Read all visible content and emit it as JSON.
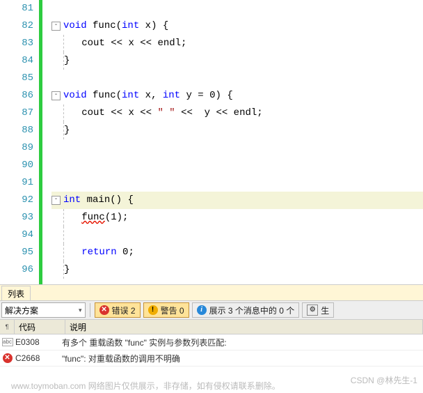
{
  "lines": {
    "81": "",
    "82_kw": "void",
    "82_fn": "func",
    "82_typ": "int",
    "82_p": "x",
    "83_stmt_a": "cout ",
    "83_stmt_b": "<< x << endl;",
    "86_kw": "void",
    "86_fn": "func",
    "86_t1": "int",
    "86_p1": "x",
    "86_t2": "int",
    "86_p2": "y",
    "86_def": " = 0",
    "87_a": "cout ",
    "87_b": "<< x << ",
    "87_str": "\" \"",
    "87_c": " <<  y << endl;",
    "92_t": "int",
    "92_fn": "main",
    "93_call": "func",
    "93_arg": "(1);",
    "95_kw": "return",
    "95_v": " 0;"
  },
  "line_numbers": [
    "81",
    "82",
    "83",
    "84",
    "85",
    "86",
    "87",
    "88",
    "89",
    "90",
    "91",
    "92",
    "93",
    "94",
    "95",
    "96"
  ],
  "panel": {
    "tab_label": "列表",
    "scope": "解决方案",
    "errors_label": "错误 2",
    "warnings_label": "警告 0",
    "messages_label": "展示 3 个消息中的 0 个",
    "build_label": "生",
    "col_code": "代码",
    "col_desc": "说明",
    "rows": [
      {
        "icon": "abc",
        "code": "E0308",
        "desc": "有多个 重载函数 \"func\" 实例与参数列表匹配:"
      },
      {
        "icon": "err",
        "code": "C2668",
        "desc": "\"func\": 对重载函数的调用不明确"
      }
    ]
  },
  "watermark": {
    "site": "www.toymoban.com   网络图片仅供展示，非存储，如有侵权请联系删除。",
    "author": "CSDN @林先生-1"
  }
}
